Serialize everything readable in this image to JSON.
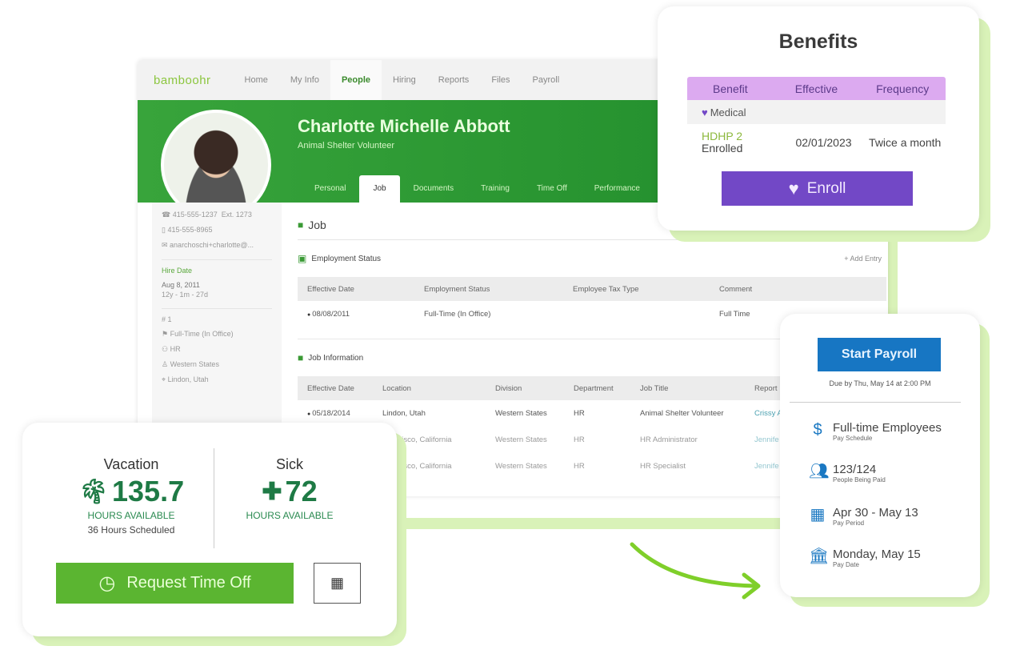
{
  "nav": {
    "logo": "bamboohr",
    "items": [
      "Home",
      "My Info",
      "People",
      "Hiring",
      "Reports",
      "Files",
      "Payroll"
    ],
    "active": "People"
  },
  "profile": {
    "name": "Charlotte Michelle Abbott",
    "title": "Animal Shelter Volunteer",
    "tabs": [
      "Personal",
      "Job",
      "Documents",
      "Training",
      "Time Off",
      "Performance"
    ],
    "active_tab": "Job"
  },
  "sidebar": {
    "phone_work": "415-555-1237",
    "ext": "Ext. 1273",
    "phone_mobile": "415-555-8965",
    "email": "anarchoschi+charlotte@...",
    "hire_label": "Hire Date",
    "hire_date": "Aug 8, 2011",
    "tenure": "12y - 1m - 27d",
    "emp_number": "1",
    "status": "Full-Time (In Office)",
    "department": "HR",
    "division": "Western States",
    "location": "Lindon, Utah"
  },
  "job": {
    "heading": "Job",
    "employment_status": {
      "title": "Employment Status",
      "add_entry": "+ Add Entry",
      "columns": [
        "Effective Date",
        "Employment Status",
        "Employee Tax Type",
        "Comment"
      ],
      "rows": [
        [
          "08/08/2011",
          "Full-Time (In Office)",
          "",
          "Full Time"
        ]
      ]
    },
    "job_information": {
      "title": "Job Information",
      "columns": [
        "Effective Date",
        "Location",
        "Division",
        "Department",
        "Job Title",
        "Report"
      ],
      "rows": [
        [
          "05/18/2014",
          "Lindon, Utah",
          "Western States",
          "HR",
          "Animal Shelter Volunteer",
          "Crissy A"
        ],
        [
          "",
          "Francisco, California",
          "Western States",
          "HR",
          "HR Administrator",
          "Jennife"
        ],
        [
          "",
          "Francisco, California",
          "Western States",
          "HR",
          "HR Specialist",
          "Jennife"
        ]
      ]
    }
  },
  "benefits": {
    "title": "Benefits",
    "columns": [
      "Benefit",
      "Effective",
      "Frequency"
    ],
    "category": "Medical",
    "plan": "HDHP 2",
    "plan_status": "Enrolled",
    "effective": "02/01/2023",
    "frequency": "Twice a month",
    "enroll_label": "Enroll",
    "colors": {
      "header": "#dcaaf0",
      "button": "#7248c6"
    }
  },
  "payroll": {
    "button": "Start Payroll",
    "due": "Due by Thu, May 14 at 2:00 PM",
    "items": [
      {
        "icon": "calendar-dollar-icon",
        "main": "Full-time Employees",
        "sub": "Pay Schedule"
      },
      {
        "icon": "people-icon",
        "main": "123/124",
        "sub": "People Being Paid"
      },
      {
        "icon": "calendar-icon",
        "main": "Apr 30 - May 13",
        "sub": "Pay Period"
      },
      {
        "icon": "bank-icon",
        "main": "Monday, May 15",
        "sub": "Pay Date"
      }
    ],
    "color": "#1776c3"
  },
  "timeoff": {
    "vacation": {
      "label": "Vacation",
      "hours": "135.7",
      "available": "HOURS AVAILABLE",
      "scheduled": "36 Hours Scheduled"
    },
    "sick": {
      "label": "Sick",
      "hours": "72",
      "available": "HOURS AVAILABLE"
    },
    "request_label": "Request Time Off",
    "color": "#5bb531"
  }
}
